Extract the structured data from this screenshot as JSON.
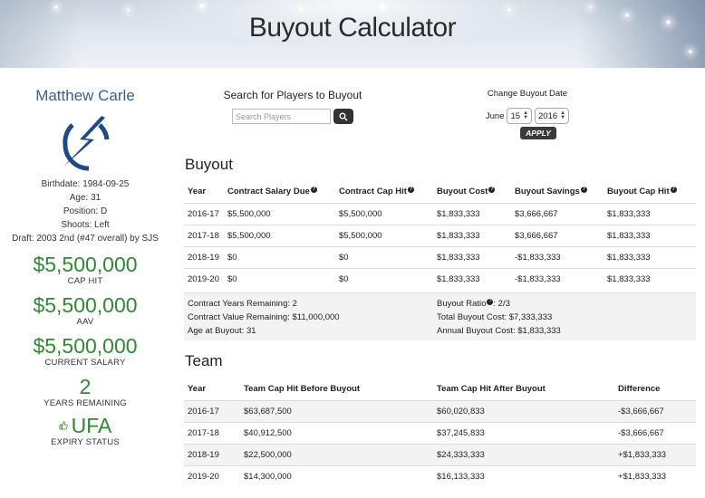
{
  "header": {
    "title": "Buyout Calculator"
  },
  "player": {
    "name": "Matthew Carle",
    "birthdate": "Birthdate: 1984-09-25",
    "age": "Age: 31",
    "position": "Position: D",
    "shoots": "Shoots: Left",
    "draft": "Draft: 2003 2nd (#47 overall) by SJS",
    "logo_icon": "lightning-bolt-logo",
    "stats": [
      {
        "value": "$5,500,000",
        "label": "CAP HIT"
      },
      {
        "value": "$5,500,000",
        "label": "AAV"
      },
      {
        "value": "$5,500,000",
        "label": "CURRENT SALARY"
      },
      {
        "value": "2",
        "label": "YEARS REMAINING"
      }
    ],
    "expiry": {
      "value": "UFA",
      "label": "EXPIRY STATUS"
    },
    "accent_color": "#2f8a2f",
    "name_color": "#3a5f8f"
  },
  "search": {
    "title": "Search for Players to Buyout",
    "placeholder": "Search Players"
  },
  "date": {
    "title": "Change Buyout Date",
    "month": "June",
    "day": "15",
    "year": "2016",
    "apply_label": "APPLY"
  },
  "buyout": {
    "title": "Buyout",
    "headers": [
      "Year",
      "Contract Salary Due",
      "Contract Cap Hit",
      "Buyout Cost",
      "Buyout Savings",
      "Buyout Cap Hit"
    ],
    "rows": [
      [
        "2016-17",
        "$5,500,000",
        "$5,500,000",
        "$1,833,333",
        "$3,666,667",
        "$1,833,333"
      ],
      [
        "2017-18",
        "$5,500,000",
        "$5,500,000",
        "$1,833,333",
        "$3,666,667",
        "$1,833,333"
      ],
      [
        "2018-19",
        "$0",
        "$0",
        "$1,833,333",
        "-$1,833,333",
        "$1,833,333"
      ],
      [
        "2019-20",
        "$0",
        "$0",
        "$1,833,333",
        "-$1,833,333",
        "$1,833,333"
      ]
    ],
    "summary_left": [
      "Contract Years Remaining: 2",
      "Contract Value Remaining: $11,000,000",
      "Age at Buyout: 31"
    ],
    "ratio_label": "Buyout Ratio",
    "ratio_value": ": 2/3",
    "summary_right": [
      "Total Buyout Cost: $7,333,333",
      "Annual Buyout Cost: $1,833,333"
    ]
  },
  "team": {
    "title": "Team",
    "headers": [
      "Year",
      "Team Cap Hit Before Buyout",
      "Team Cap Hit After Buyout",
      "Difference"
    ],
    "rows": [
      [
        "2016-17",
        "$63,687,500",
        "$60,020,833",
        "-$3,666,667"
      ],
      [
        "2017-18",
        "$40,912,500",
        "$37,245,833",
        "-$3,666,667"
      ],
      [
        "2018-19",
        "$22,500,000",
        "$24,333,333",
        "+$1,833,333"
      ],
      [
        "2019-20",
        "$14,300,000",
        "$16,133,333",
        "+$1,833,333"
      ]
    ],
    "negative_color": "#2f8a2f",
    "positive_color": "#cc2233"
  }
}
